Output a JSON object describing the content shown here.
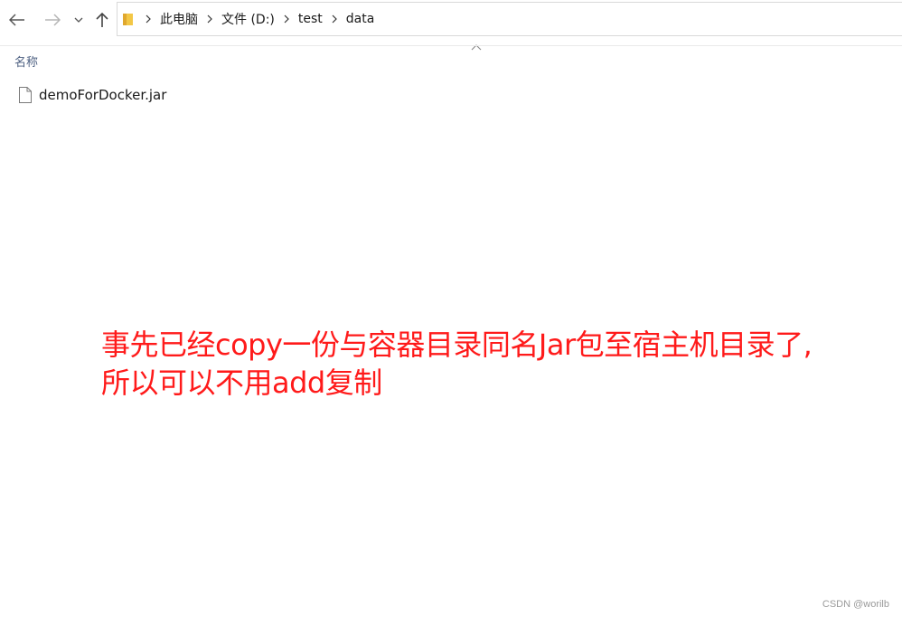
{
  "navigation": {
    "back_icon": "arrow-left-icon",
    "forward_icon": "arrow-right-icon",
    "recent_icon": "chevron-down-icon",
    "up_icon": "arrow-up-icon"
  },
  "address_bar": {
    "folder_icon": "folder-icon",
    "separator_icon": "chevron-right-icon",
    "crumbs": [
      "此电脑",
      "文件 (D:)",
      "test",
      "data"
    ]
  },
  "file_list": {
    "column_header": "名称",
    "sort_indicator_icon": "chevron-up-icon",
    "files": [
      {
        "name": "demoForDocker.jar",
        "icon": "file-icon"
      }
    ]
  },
  "annotation": {
    "line1": "事先已经copy一份与容器目录同名Jar包至宿主机目录了,",
    "line2": "所以可以不用add复制",
    "color": "#ff1a1a"
  },
  "watermark": "CSDN @worilb"
}
